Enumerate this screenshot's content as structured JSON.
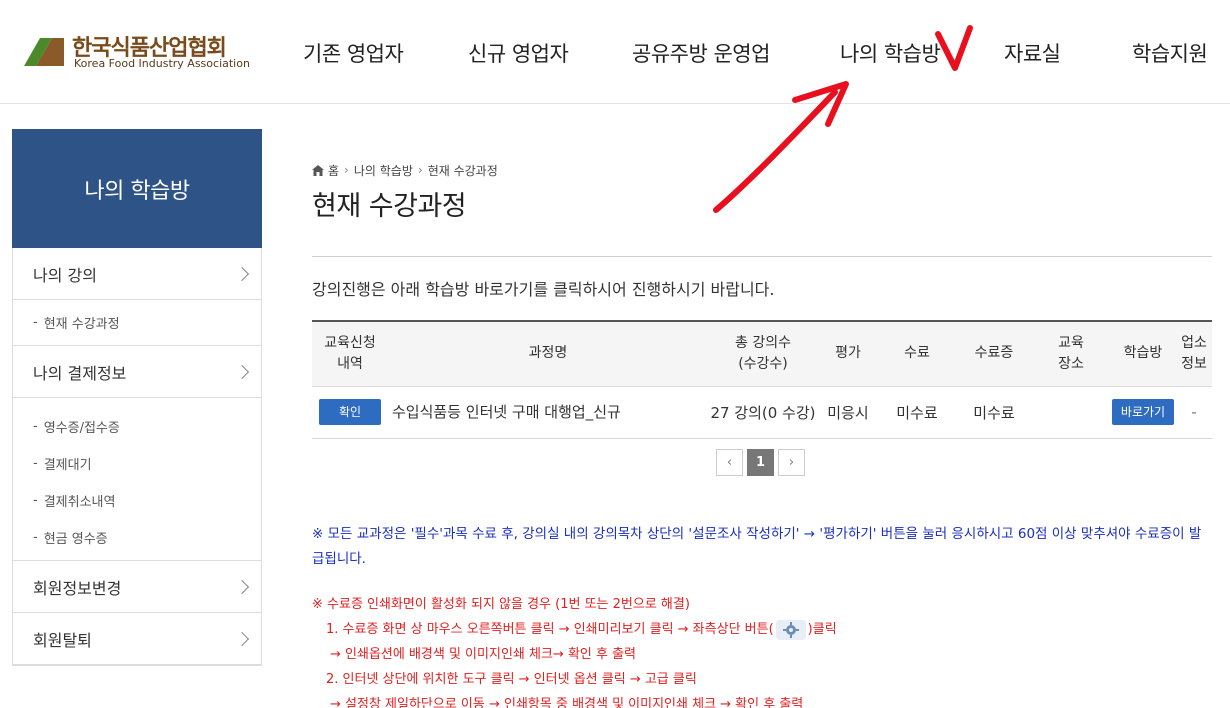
{
  "logo": {
    "name_ko": "한국식품산업협회",
    "name_en": "Korea Food Industry Association"
  },
  "nav": {
    "items": [
      "기존 영업자",
      "신규 영업자",
      "공유주방 운영업",
      "나의 학습방",
      "자료실",
      "학습지원"
    ]
  },
  "sidebar": {
    "title": "나의 학습방",
    "my_courses": "나의 강의",
    "current_courses": "현재 수강과정",
    "payment_info": "나의 결제정보",
    "receipt": "영수증/접수증",
    "payment_pending": "결제대기",
    "payment_cancel": "결제취소내역",
    "cash_receipt": "현금 영수증",
    "member_edit": "회원정보변경",
    "withdraw": "회원탈퇴"
  },
  "breadcrumb": {
    "home": "홈",
    "level1": "나의 학습방",
    "level2": "현재 수강과정"
  },
  "page": {
    "title": "현재 수강과정",
    "intro": "강의진행은 아래 학습방 바로가기를 클릭하시어 진행하시기 바랍니다."
  },
  "table": {
    "headers": {
      "apply_1": "교육신청",
      "apply_2": "내역",
      "course_name": "과정명",
      "lectures_1": "총 강의수",
      "lectures_2": "(수강수)",
      "evaluation": "평가",
      "completion": "수료",
      "certificate": "수료증",
      "place_1": "교육",
      "place_2": "장소",
      "study_room": "학습방",
      "biz_1": "업소",
      "biz_2": "정보"
    },
    "row": {
      "confirm_label": "확인",
      "course_name": "수입식품등 인터넷 구매 대행업_신규",
      "lectures": "27 강의(0 수강)",
      "evaluation": "미응시",
      "completion": "미수료",
      "certificate": "미수료",
      "place": "",
      "go_label": "바로가기",
      "biz_info": "-"
    }
  },
  "pager": {
    "prev": "‹",
    "current": "1",
    "next": "›"
  },
  "notice": {
    "blue": "※ 모든 교과정은 '필수'과목 수료 후, 강의실 내의 강의목차 상단의 '설문조사 작성하기' → '평가하기' 버튼을 눌러 응시하시고 60점 이상 맞추셔야 수료증이 발급됩니다.",
    "red_title": "※ 수료증 인쇄화면이 활성화 되지 않을 경우 (1번 또는 2번으로 해결)",
    "red_1a_before": "1. 수료증 화면 상 마우스 오른쪽버튼 클릭 → 인쇄미리보기 클릭 → 좌측상단 버튼(",
    "red_1a_after": ")클릭",
    "red_1b": "→ 인쇄옵션에 배경색 및 이미지인쇄 체크→ 확인 후 출력",
    "red_2a": "2. 인터넷 상단에 위치한 도구 클릭 → 인터넷 옵션 클릭 → 고급 클릭",
    "red_2b": "→ 설정창 제일하단으로 이동 → 인쇄항목 중 배경색 및 이미지인쇄 체크 → 확인 후 출력"
  },
  "colors": {
    "sidebar_title_bg": "#2e5387",
    "button_blue": "#2d6cc0",
    "annotation_red": "#e8101e",
    "notice_blue": "#1a2fbf",
    "notice_red": "#e02020"
  },
  "icons": [
    "home-icon",
    "gear-icon",
    "chevron-right-icon",
    "logo-mark"
  ]
}
